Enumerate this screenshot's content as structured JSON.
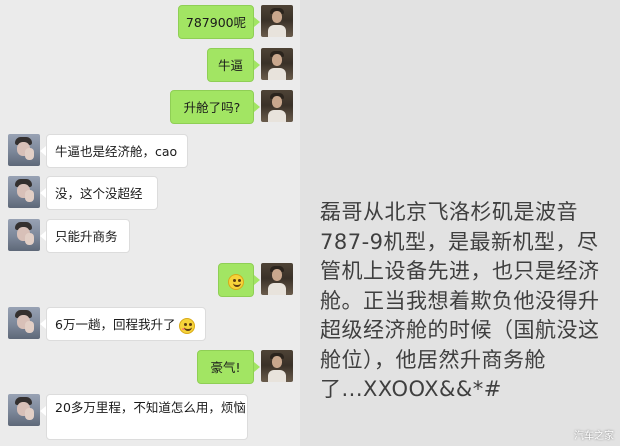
{
  "chat": {
    "messages": [
      {
        "side": "out",
        "text": "787900呢"
      },
      {
        "side": "out",
        "text": "牛逼"
      },
      {
        "side": "out",
        "text": "升舱了吗?"
      },
      {
        "side": "in",
        "text": "牛逼也是经济舱，cao"
      },
      {
        "side": "in",
        "text": "没，这个没超经"
      },
      {
        "side": "in",
        "text": "只能升商务"
      },
      {
        "side": "out",
        "text": "",
        "emoji": "grinning-emoji"
      },
      {
        "side": "in",
        "text": "6万一趟，回程我升了",
        "emoji": "embarrassed-emoji"
      },
      {
        "side": "out",
        "text": "豪气!"
      },
      {
        "side": "in",
        "text": "20多万里程，不知道怎么用，烦恼"
      }
    ]
  },
  "caption": {
    "text": "磊哥从北京飞洛杉矶是波音787-9机型，是最新机型，尽管机上设备先进，也只是经济舱。正当我想着欺负他没得升超级经济舱的时候（国航没这舱位），他居然升商务舱了...XXOOX&&*#"
  },
  "watermark": "汽车之家"
}
